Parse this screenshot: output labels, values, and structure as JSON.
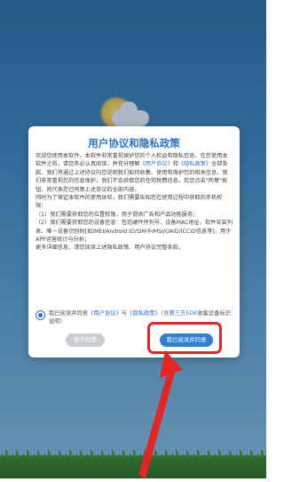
{
  "dialog": {
    "title": "用户协议和隐私政策",
    "body": {
      "p1_a": "欢迎您使用本软件。本软件非常重视保护您的个人权益和隐私信息。在您使用本软件之前，请您务必认真阅读，并充分理解",
      "p1_link1": "《用户协议》",
      "p1_b": "和",
      "p1_link2": "《隐私政策》",
      "p1_c": "全部条款。我们将通过上述协议向您说明我们如何收集、使用和保护您的相关信息，我们非常重视您的信息保护，我们不会获取您的任何税费信息。若您点击\"同意\"按钮，则代表您已同意上述协议的全部内容。",
      "p2": "同时为了保证本软件的使用体验，我们需要告知您在使用过程中获取的手机权限：",
      "p3": "（1）我们需要获取您的位置权限，用于提供广告和产品功能服务；",
      "p4": "（2）我们需要获取您的设备信息：包括硬件序列号、设备MAC地址、软件安装列表、唯一设备识别码[如IMEI/Android ID/SIM卡IMSI/OAID/ICCID信息等]，用于APP运营统计与分析；",
      "p5": "更多详细信息，请您阅读上述隐私政策、用户协议完整条款。"
    },
    "agree_text": {
      "a": "我已阅读并同意",
      "link1": "《用户协议》",
      "b": "与",
      "link2": "《隐私政策》",
      "c": "（含",
      "link3": "第三方SDK",
      "d": "收集设备标识说明）"
    },
    "buttons": {
      "disagree": "暂不同意",
      "agree": "我已阅读并同意"
    }
  },
  "colors": {
    "accent": "#2b73c9",
    "annotation": "#e62424",
    "disabled_button": "#c9cdd2"
  }
}
